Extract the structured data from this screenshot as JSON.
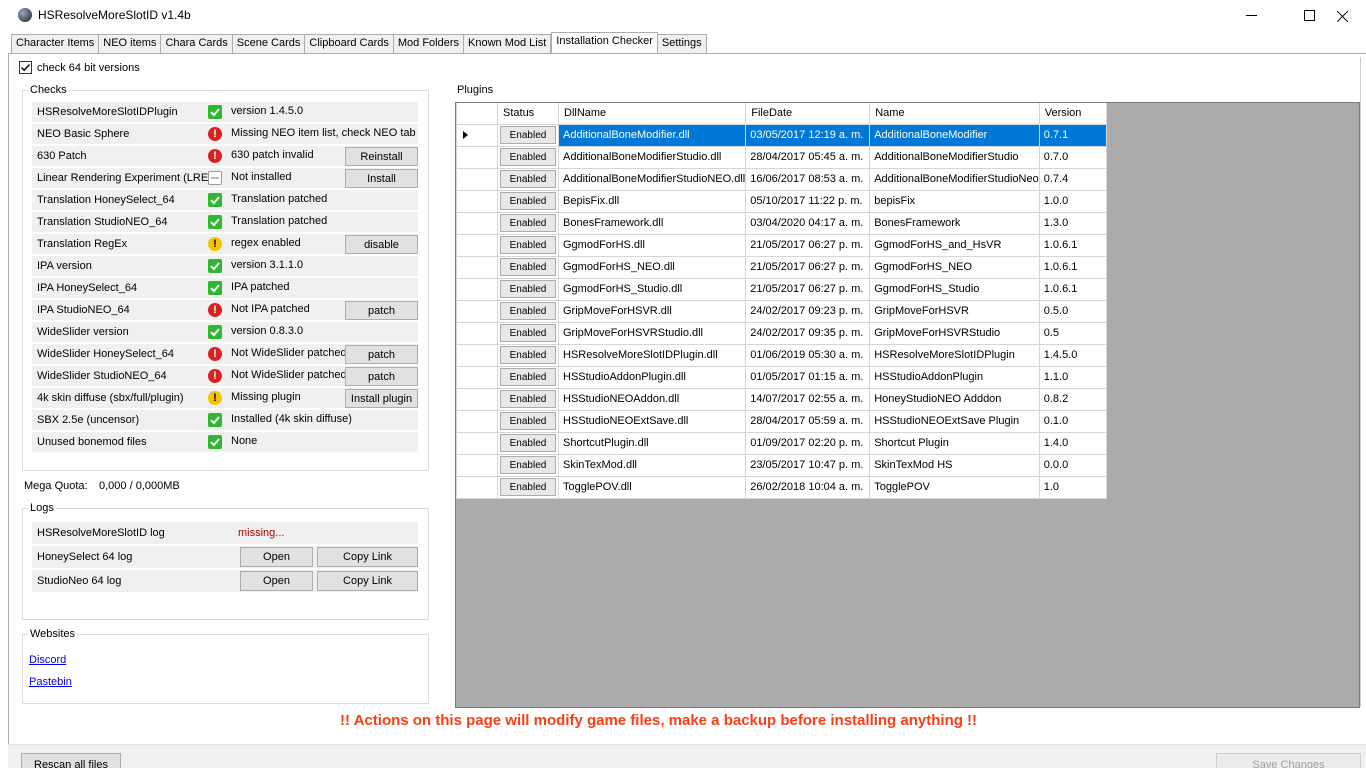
{
  "window": {
    "title": "HSResolveMoreSlotID v1.4b"
  },
  "tabs": [
    "Character Items",
    "NEO items",
    "Chara Cards",
    "Scene Cards",
    "Clipboard Cards",
    "Mod Folders",
    "Known Mod List",
    "Installation Checker",
    "Settings"
  ],
  "active_tab": "Installation Checker",
  "check64": {
    "label": "check 64 bit versions",
    "checked": true
  },
  "checks": {
    "title": "Checks",
    "rows": [
      {
        "name": "HSResolveMoreSlotIDPlugin",
        "icon": "ok",
        "status": "version 1.4.5.0",
        "button": ""
      },
      {
        "name": "NEO Basic Sphere",
        "icon": "error",
        "status": "Missing NEO item list, check NEO tab",
        "button": ""
      },
      {
        "name": "630 Patch",
        "icon": "error",
        "status": "630 patch invalid",
        "button": "Reinstall"
      },
      {
        "name": "Linear Rendering Experiment (LRE)",
        "icon": "none",
        "status": "Not installed",
        "button": "Install"
      },
      {
        "name": "Translation HoneySelect_64",
        "icon": "ok",
        "status": "Translation patched",
        "button": ""
      },
      {
        "name": "Translation StudioNEO_64",
        "icon": "ok",
        "status": "Translation patched",
        "button": ""
      },
      {
        "name": "Translation RegEx",
        "icon": "warning",
        "status": "regex enabled",
        "button": "disable"
      },
      {
        "name": "IPA version",
        "icon": "ok",
        "status": "version 3.1.1.0",
        "button": ""
      },
      {
        "name": "IPA HoneySelect_64",
        "icon": "ok",
        "status": "IPA patched",
        "button": ""
      },
      {
        "name": "IPA StudioNEO_64",
        "icon": "error",
        "status": "Not IPA patched",
        "button": "patch"
      },
      {
        "name": "WideSlider version",
        "icon": "ok",
        "status": "version 0.8.3.0",
        "button": ""
      },
      {
        "name": "WideSlider HoneySelect_64",
        "icon": "error",
        "status": "Not WideSlider patched",
        "button": "patch"
      },
      {
        "name": "WideSlider StudioNEO_64",
        "icon": "error",
        "status": "Not WideSlider patched",
        "button": "patch"
      },
      {
        "name": "4k skin diffuse (sbx/full/plugin)",
        "icon": "warning",
        "status": "Missing plugin",
        "button": "Install plugin"
      },
      {
        "name": "SBX 2.5e (uncensor)",
        "icon": "ok",
        "status": "Installed (4k skin diffuse)",
        "button": ""
      },
      {
        "name": "Unused bonemod files",
        "icon": "ok",
        "status": "None",
        "button": ""
      }
    ]
  },
  "mega": {
    "label": "Mega Quota:",
    "value": "0,000 / 0,000MB"
  },
  "logs": {
    "title": "Logs",
    "rows": [
      {
        "name": "HSResolveMoreSlotID log",
        "status": "missing...",
        "open": "",
        "copy": ""
      },
      {
        "name": "HoneySelect 64 log",
        "status": "",
        "open": "Open",
        "copy": "Copy Link"
      },
      {
        "name": "StudioNeo 64 log",
        "status": "",
        "open": "Open",
        "copy": "Copy Link"
      }
    ]
  },
  "websites": {
    "title": "Websites",
    "links": [
      "Discord",
      "Pastebin"
    ]
  },
  "plugins": {
    "title": "Plugins",
    "columns": [
      "Status",
      "DllName",
      "FileDate",
      "Name",
      "Version"
    ],
    "selected_index": 0,
    "rows": [
      {
        "status": "Enabled",
        "dll": "AdditionalBoneModifier.dll",
        "date": "03/05/2017 12:19 a. m.",
        "name": "AdditionalBoneModifier",
        "version": "0.7.1"
      },
      {
        "status": "Enabled",
        "dll": "AdditionalBoneModifierStudio.dll",
        "date": "28/04/2017 05:45 a. m.",
        "name": "AdditionalBoneModifierStudio",
        "version": "0.7.0"
      },
      {
        "status": "Enabled",
        "dll": "AdditionalBoneModifierStudioNEO.dll",
        "date": "16/06/2017 08:53 a. m.",
        "name": "AdditionalBoneModifierStudioNeo",
        "version": "0.7.4"
      },
      {
        "status": "Enabled",
        "dll": "BepisFix.dll",
        "date": "05/10/2017 11:22 p. m.",
        "name": "bepisFix",
        "version": "1.0.0"
      },
      {
        "status": "Enabled",
        "dll": "BonesFramework.dll",
        "date": "03/04/2020 04:17 a. m.",
        "name": "BonesFramework",
        "version": "1.3.0"
      },
      {
        "status": "Enabled",
        "dll": "GgmodForHS.dll",
        "date": "21/05/2017 06:27 p. m.",
        "name": "GgmodForHS_and_HsVR",
        "version": "1.0.6.1"
      },
      {
        "status": "Enabled",
        "dll": "GgmodForHS_NEO.dll",
        "date": "21/05/2017 06:27 p. m.",
        "name": "GgmodForHS_NEO",
        "version": "1.0.6.1"
      },
      {
        "status": "Enabled",
        "dll": "GgmodForHS_Studio.dll",
        "date": "21/05/2017 06:27 p. m.",
        "name": "GgmodForHS_Studio",
        "version": "1.0.6.1"
      },
      {
        "status": "Enabled",
        "dll": "GripMoveForHSVR.dll",
        "date": "24/02/2017 09:23 p. m.",
        "name": "GripMoveForHSVR",
        "version": "0.5.0"
      },
      {
        "status": "Enabled",
        "dll": "GripMoveForHSVRStudio.dll",
        "date": "24/02/2017 09:35 p. m.",
        "name": "GripMoveForHSVRStudio",
        "version": "0.5"
      },
      {
        "status": "Enabled",
        "dll": "HSResolveMoreSlotIDPlugin.dll",
        "date": "01/06/2019 05:30 a. m.",
        "name": "HSResolveMoreSlotIDPlugin",
        "version": "1.4.5.0"
      },
      {
        "status": "Enabled",
        "dll": "HSStudioAddonPlugin.dll",
        "date": "01/05/2017 01:15 a. m.",
        "name": "HSStudioAddonPlugin",
        "version": "1.1.0"
      },
      {
        "status": "Enabled",
        "dll": "HSStudioNEOAddon.dll",
        "date": "14/07/2017 02:55 a. m.",
        "name": "HoneyStudioNEO Adddon",
        "version": "0.8.2"
      },
      {
        "status": "Enabled",
        "dll": "HSStudioNEOExtSave.dll",
        "date": "28/04/2017 05:59 a. m.",
        "name": "HSStudioNEOExtSave Plugin",
        "version": "0.1.0"
      },
      {
        "status": "Enabled",
        "dll": "ShortcutPlugin.dll",
        "date": "01/09/2017 02:20 p. m.",
        "name": "Shortcut Plugin",
        "version": "1.4.0"
      },
      {
        "status": "Enabled",
        "dll": "SkinTexMod.dll",
        "date": "23/05/2017 10:47 p. m.",
        "name": "SkinTexMod HS",
        "version": "0.0.0"
      },
      {
        "status": "Enabled",
        "dll": "TogglePOV.dll",
        "date": "26/02/2018 10:04 a. m.",
        "name": "TogglePOV",
        "version": "1.0"
      }
    ]
  },
  "warning_text": "!! Actions on this page will modify game files, make a backup before installing anything  !!",
  "footer": {
    "rescan": "Rescan all files",
    "save": "Save Changes"
  },
  "colors": {
    "selection": "#0078d7",
    "warning_text": "#ff3c14",
    "ok": "#2eb82e",
    "error": "#d92121",
    "warn": "#f5c400"
  }
}
